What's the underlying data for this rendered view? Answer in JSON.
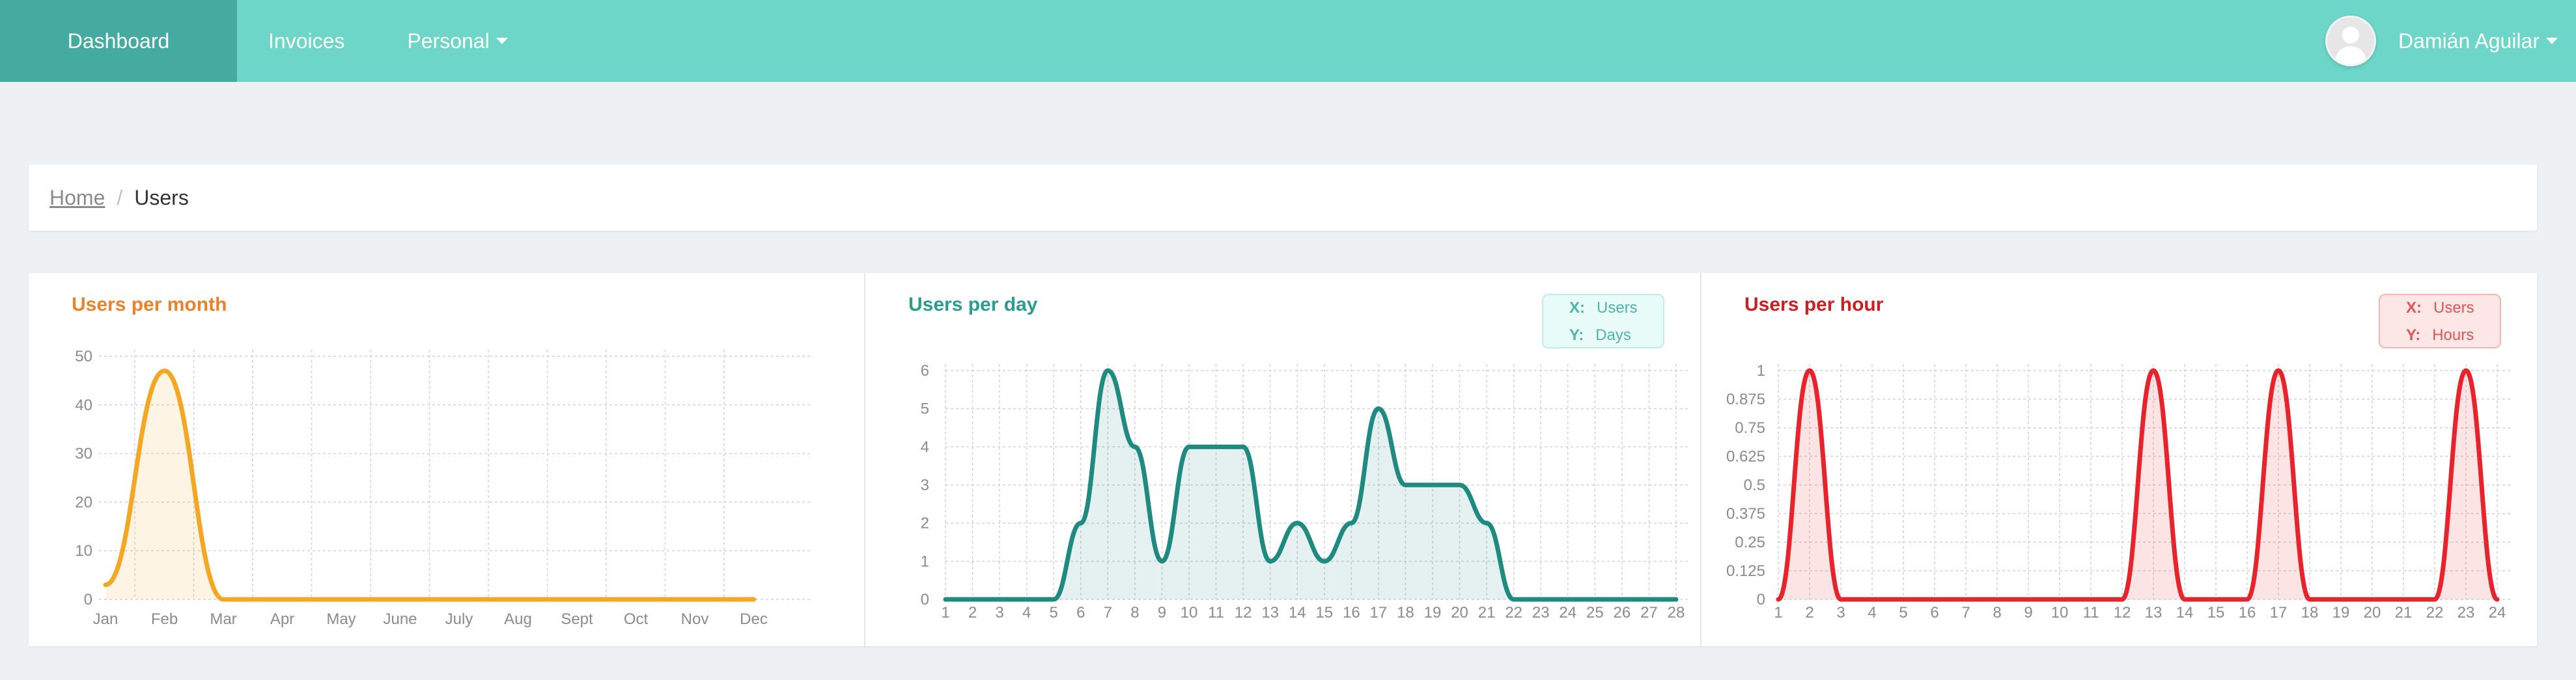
{
  "nav": {
    "items": [
      {
        "label": "Dashboard"
      },
      {
        "label": "Invoices"
      },
      {
        "label": "Personal"
      }
    ],
    "user_name": "Damián Aguilar"
  },
  "breadcrumb": {
    "home": "Home",
    "separator": "/",
    "current": "Users"
  },
  "chart_data": [
    {
      "type": "area",
      "title": "Users per month",
      "color": "#f5a623",
      "x": [
        "Jan",
        "Feb",
        "Mar",
        "Apr",
        "May",
        "June",
        "July",
        "Aug",
        "Sept",
        "Oct",
        "Nov",
        "Dec"
      ],
      "values": [
        3,
        47,
        0,
        0,
        0,
        0,
        0,
        0,
        0,
        0,
        0,
        0
      ],
      "ylim": [
        0,
        50
      ],
      "yticks": [
        "0",
        "10",
        "20",
        "30",
        "40",
        "50"
      ],
      "grid": true
    },
    {
      "type": "area",
      "title": "Users per day",
      "color": "#1e8a80",
      "legend": {
        "x_key": "X:",
        "x_val": "Users",
        "y_key": "Y:",
        "y_val": "Days"
      },
      "x": [
        "1",
        "2",
        "3",
        "4",
        "5",
        "6",
        "7",
        "8",
        "9",
        "10",
        "11",
        "12",
        "13",
        "14",
        "15",
        "16",
        "17",
        "18",
        "19",
        "20",
        "21",
        "22",
        "23",
        "24",
        "25",
        "26",
        "27",
        "28"
      ],
      "values": [
        0,
        0,
        0,
        0,
        0,
        2,
        6,
        4,
        1,
        4,
        4,
        4,
        1,
        2,
        1,
        2,
        5,
        3,
        3,
        3,
        2,
        0,
        0,
        0,
        0,
        0,
        0,
        0
      ],
      "ylim": [
        0,
        6
      ],
      "yticks": [
        "0",
        "1",
        "2",
        "3",
        "4",
        "5",
        "6"
      ],
      "grid": true
    },
    {
      "type": "area",
      "title": "Users per hour",
      "color": "#e8232c",
      "legend": {
        "x_key": "X:",
        "x_val": "Users",
        "y_key": "Y:",
        "y_val": "Hours"
      },
      "x": [
        "1",
        "2",
        "3",
        "4",
        "5",
        "6",
        "7",
        "8",
        "9",
        "10",
        "11",
        "12",
        "13",
        "14",
        "15",
        "16",
        "17",
        "18",
        "19",
        "20",
        "21",
        "22",
        "23",
        "24"
      ],
      "values": [
        0,
        1,
        0,
        0,
        0,
        0,
        0,
        0,
        0,
        0,
        0,
        0,
        1,
        0,
        0,
        0,
        1,
        0,
        0,
        0,
        0,
        0,
        1,
        0
      ],
      "ylim": [
        0,
        1
      ],
      "yticks": [
        "0",
        "0.125",
        "0.25",
        "0.375",
        "0.5",
        "0.625",
        "0.75",
        "0.875",
        "1"
      ],
      "grid": true
    }
  ]
}
